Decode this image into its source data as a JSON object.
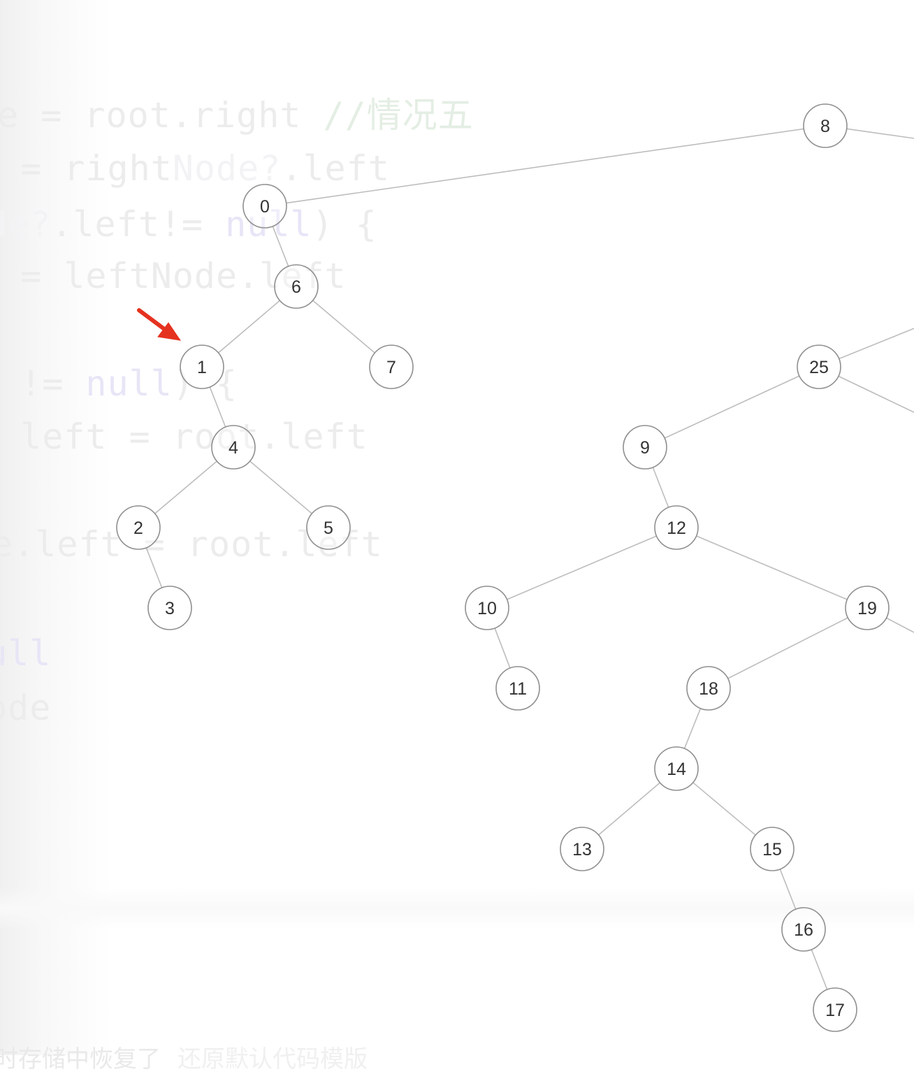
{
  "background_code": {
    "lines": [
      [
        {
          "t": "e = root.right ",
          "c": "code"
        },
        {
          "t": "//情况五",
          "c": "cm"
        }
      ],
      [
        {
          "t": " = right",
          "c": "code"
        },
        {
          "t": "Node?",
          "c": "lt"
        },
        {
          "t": ".left",
          "c": "code"
        }
      ],
      [
        {
          "t": "de?",
          "c": "lt"
        },
        {
          "t": ".left!= ",
          "c": "code"
        },
        {
          "t": "null",
          "c": "kw"
        },
        {
          "t": ") {",
          "c": "code"
        }
      ],
      [
        {
          "t": " = leftNode.left",
          "c": "code"
        }
      ],
      [
        {
          "t": " != ",
          "c": "code"
        },
        {
          "t": "null",
          "c": "kw"
        },
        {
          "t": ") {",
          "c": "code"
        }
      ],
      [
        {
          "t": " left = root.left",
          "c": "code"
        }
      ],
      [
        {
          "t": "e.left = root.left",
          "c": "code"
        }
      ],
      [
        {
          "t": "ull",
          "c": "kw"
        }
      ],
      [
        {
          "t": "ode",
          "c": "code"
        }
      ]
    ],
    "footer_text": "时存储中恢复了",
    "footer_link": "还原默认代码模版"
  },
  "tree": {
    "nodes": [
      "8",
      "0",
      "6",
      "1",
      "7",
      "4",
      "2",
      "5",
      "3",
      "25",
      "9",
      "12",
      "10",
      "19",
      "11",
      "18",
      "14",
      "13",
      "15",
      "16",
      "17"
    ],
    "edges": [
      [
        "8",
        "0"
      ],
      [
        "0",
        "6"
      ],
      [
        "6",
        "1"
      ],
      [
        "6",
        "7"
      ],
      [
        "1",
        "4"
      ],
      [
        "4",
        "2"
      ],
      [
        "4",
        "5"
      ],
      [
        "2",
        "3"
      ],
      [
        "25",
        "9"
      ],
      [
        "9",
        "12"
      ],
      [
        "12",
        "10"
      ],
      [
        "12",
        "19"
      ],
      [
        "10",
        "11"
      ],
      [
        "19",
        "18"
      ],
      [
        "18",
        "14"
      ],
      [
        "14",
        "13"
      ],
      [
        "14",
        "15"
      ],
      [
        "15",
        "16"
      ],
      [
        "16",
        "17"
      ]
    ],
    "offscreen_edges_from": [
      "8",
      "25",
      "25",
      "19"
    ]
  },
  "annotation": {
    "arrow_color": "#e5321f",
    "points_to": "1"
  }
}
